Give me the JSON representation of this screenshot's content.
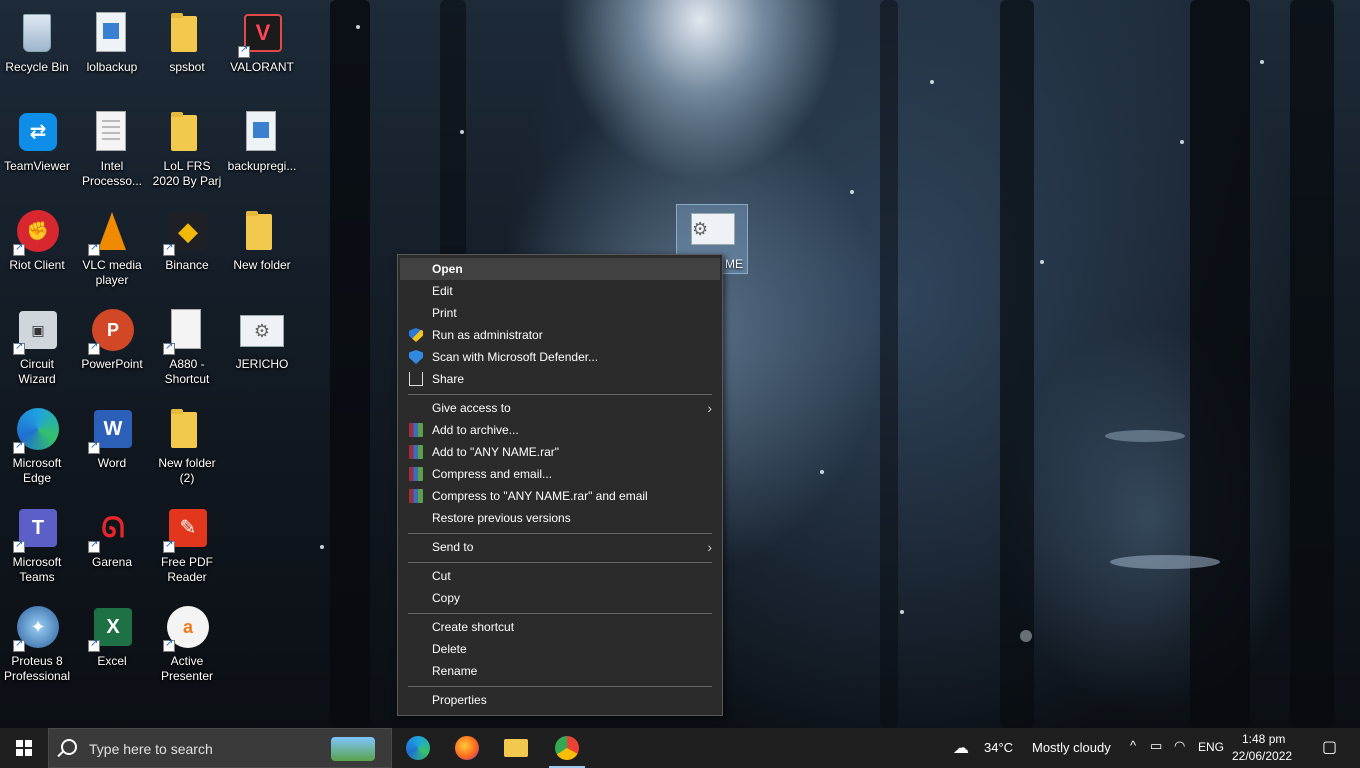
{
  "desktop": {
    "icons": [
      {
        "label": "Recycle Bin",
        "icon": "recycle-bin-icon"
      },
      {
        "label": "lolbackup",
        "icon": "registry-file-icon"
      },
      {
        "label": "spsbot",
        "icon": "folder-icon"
      },
      {
        "label": "VALORANT",
        "icon": "valorant-icon"
      },
      {
        "label": "TeamViewer",
        "icon": "teamviewer-icon"
      },
      {
        "label": "Intel Processo...",
        "icon": "document-icon"
      },
      {
        "label": "LoL FRS 2020 By Parj",
        "icon": "folder-icon"
      },
      {
        "label": "backupregi...",
        "icon": "registry-file-icon"
      },
      {
        "label": "Riot Client",
        "icon": "riot-client-icon"
      },
      {
        "label": "VLC media player",
        "icon": "vlc-icon"
      },
      {
        "label": "Binance",
        "icon": "binance-icon"
      },
      {
        "label": "New folder",
        "icon": "folder-icon"
      },
      {
        "label": "Circuit Wizard",
        "icon": "circuit-wizard-icon"
      },
      {
        "label": "PowerPoint",
        "icon": "powerpoint-icon"
      },
      {
        "label": "A880 - Shortcut",
        "icon": "blank-document-icon"
      },
      {
        "label": "JERICHO",
        "icon": "settings-file-icon"
      },
      {
        "label": "Microsoft Edge",
        "icon": "edge-icon"
      },
      {
        "label": "Word",
        "icon": "word-icon"
      },
      {
        "label": "New folder (2)",
        "icon": "folder-icon"
      },
      {
        "label": "Microsoft Teams",
        "icon": "teams-icon"
      },
      {
        "label": "Garena",
        "icon": "garena-icon"
      },
      {
        "label": "Free PDF Reader",
        "icon": "pdf-reader-icon"
      },
      {
        "label": "Proteus 8 Professional",
        "icon": "proteus-icon"
      },
      {
        "label": "Excel",
        "icon": "excel-icon"
      },
      {
        "label": "Active Presenter",
        "icon": "active-presenter-icon"
      }
    ],
    "selected_icon_label_fragment": "ME"
  },
  "context_menu": {
    "items": [
      {
        "label": "Open",
        "icon": null
      },
      {
        "label": "Edit",
        "icon": null
      },
      {
        "label": "Print",
        "icon": null
      },
      {
        "label": "Run as administrator",
        "icon": "uac-shield-icon"
      },
      {
        "label": "Scan with Microsoft Defender...",
        "icon": "defender-shield-icon"
      },
      {
        "label": "Share",
        "icon": "share-icon"
      },
      {
        "label": "Give access to",
        "icon": null
      },
      {
        "label": "Add to archive...",
        "icon": "winrar-icon"
      },
      {
        "label": "Add to \"ANY NAME.rar\"",
        "icon": "winrar-icon"
      },
      {
        "label": "Compress and email...",
        "icon": "winrar-icon"
      },
      {
        "label": "Compress to \"ANY NAME.rar\" and email",
        "icon": "winrar-icon"
      },
      {
        "label": "Restore previous versions",
        "icon": null
      },
      {
        "label": "Send to",
        "icon": null
      },
      {
        "label": "Cut",
        "icon": null
      },
      {
        "label": "Copy",
        "icon": null
      },
      {
        "label": "Create shortcut",
        "icon": null
      },
      {
        "label": "Delete",
        "icon": null
      },
      {
        "label": "Rename",
        "icon": null
      },
      {
        "label": "Properties",
        "icon": null
      }
    ],
    "submenu_arrow": "›"
  },
  "taskbar": {
    "search_placeholder": "Type here to search",
    "pinned": [
      {
        "name": "edge-taskbar-icon"
      },
      {
        "name": "firefox-taskbar-icon"
      },
      {
        "name": "file-explorer-taskbar-icon"
      },
      {
        "name": "chrome-taskbar-icon"
      }
    ],
    "weather_temp": "34°C",
    "weather_desc": "Mostly cloudy",
    "language": "ENG",
    "time": "1:48 pm",
    "date": "22/06/2022"
  },
  "colors": {
    "menu_bg": "#2b2b2b",
    "menu_highlight": "#414141",
    "taskbar_bg": "#1f1f1f"
  }
}
